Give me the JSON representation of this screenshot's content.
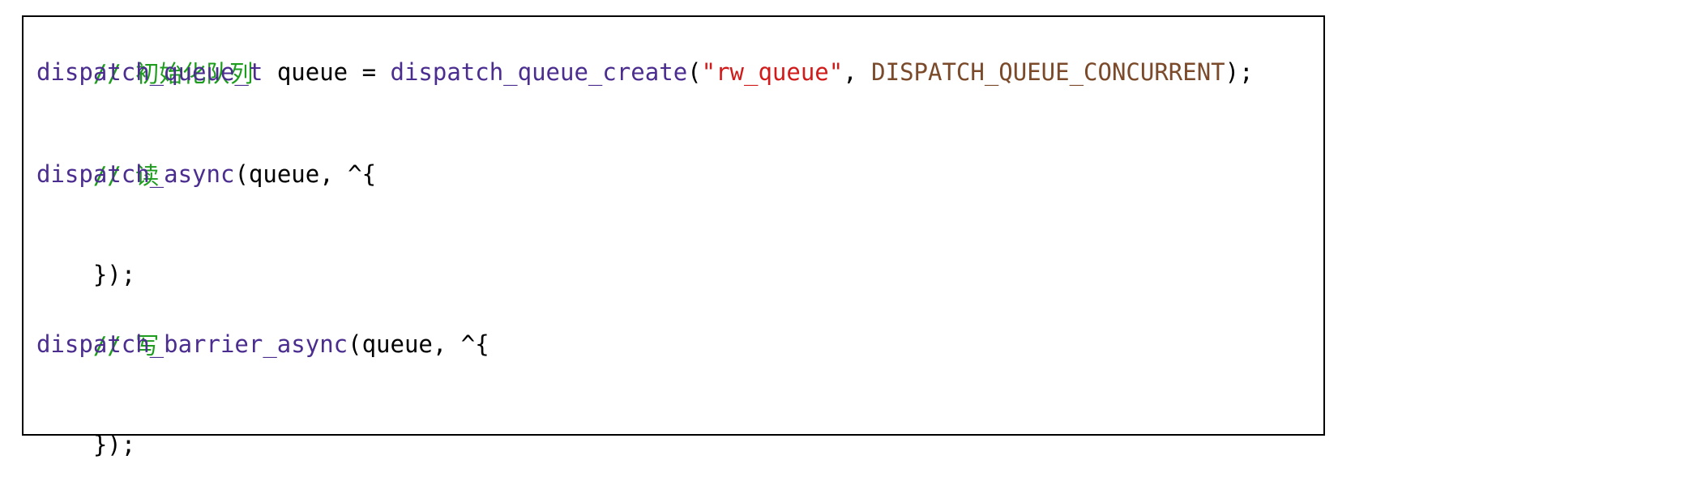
{
  "colors": {
    "comment": "#1d9c1d",
    "function": "#4b2d8f",
    "string": "#d11a1a",
    "constant": "#7a4a2a",
    "plain": "#000000",
    "border": "#000000",
    "background": "#ffffff"
  },
  "code": {
    "line1": {
      "comment": "// 初始化队列"
    },
    "line2": {
      "type": "dispatch_queue_t",
      "decl": " queue = ",
      "fn": "dispatch_queue_create",
      "open": "(",
      "str": "\"rw_queue\"",
      "comma": ", ",
      "const": "DISPATCH_QUEUE_CONCURRENT",
      "close": ");"
    },
    "line3": {
      "comment": "// 读"
    },
    "line4": {
      "fn": "dispatch_async",
      "rest": "(queue, ^{"
    },
    "line5": {
      "text": "});"
    },
    "line6": {
      "comment": "// 写"
    },
    "line7": {
      "fn": "dispatch_barrier_async",
      "rest": "(queue, ^{"
    },
    "line8": {
      "text": "});"
    }
  }
}
